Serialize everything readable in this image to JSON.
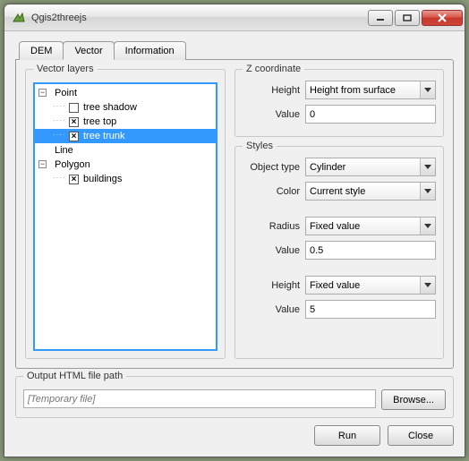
{
  "window": {
    "title": "Qgis2threejs"
  },
  "tabs": {
    "dem": "DEM",
    "vector": "Vector",
    "information": "Information",
    "active": "Vector"
  },
  "layers": {
    "title": "Vector layers",
    "tree": {
      "point": {
        "label": "Point",
        "expanded": true,
        "children": [
          {
            "label": "tree shadow",
            "checked": false
          },
          {
            "label": "tree top",
            "checked": true
          },
          {
            "label": "tree trunk",
            "checked": true,
            "selected": true
          }
        ]
      },
      "line": {
        "label": "Line"
      },
      "polygon": {
        "label": "Polygon",
        "expanded": true,
        "children": [
          {
            "label": "buildings",
            "checked": true
          }
        ]
      }
    }
  },
  "zcoord": {
    "title": "Z coordinate",
    "height_label": "Height",
    "height_value": "Height from surface",
    "value_label": "Value",
    "value_value": "0"
  },
  "styles": {
    "title": "Styles",
    "object_label": "Object type",
    "object_value": "Cylinder",
    "color_label": "Color",
    "color_value": "Current style",
    "radius_label": "Radius",
    "radius_mode": "Fixed value",
    "radius_value_label": "Value",
    "radius_value": "0.5",
    "height_label": "Height",
    "height_mode": "Fixed value",
    "height_value_label": "Value",
    "height_value": "5"
  },
  "output": {
    "title": "Output HTML file path",
    "placeholder": "[Temporary file]",
    "browse": "Browse..."
  },
  "buttons": {
    "run": "Run",
    "close": "Close"
  }
}
